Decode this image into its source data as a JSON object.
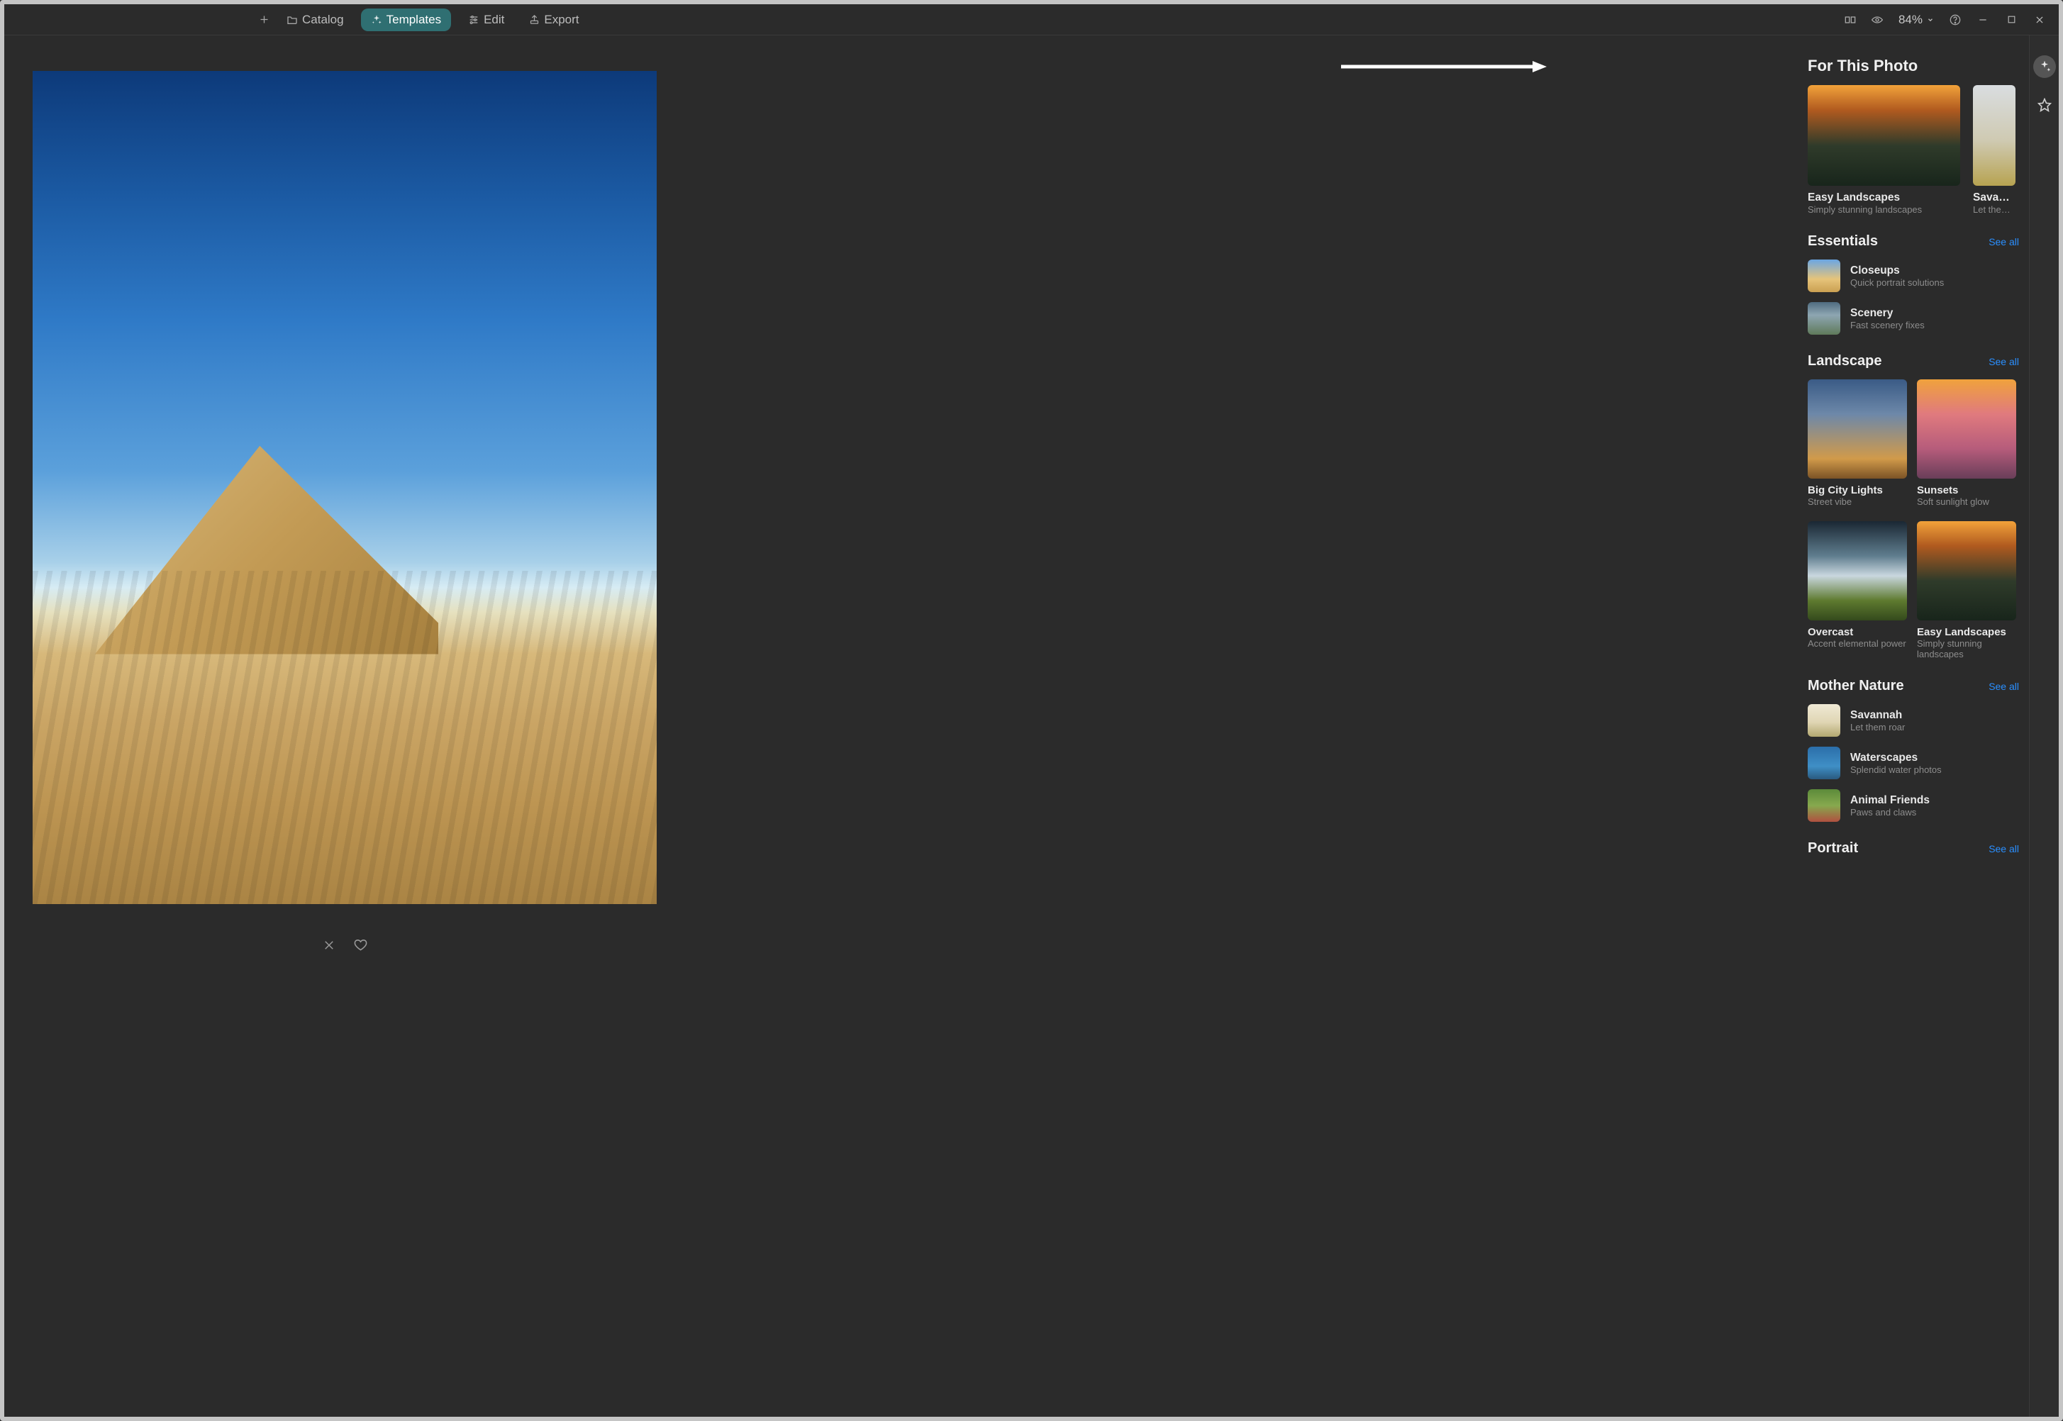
{
  "topbar": {
    "catalog": "Catalog",
    "templates": "Templates",
    "edit": "Edit",
    "export": "Export",
    "zoom": "84%"
  },
  "sidebar": {
    "for_this_photo": {
      "title": "For This Photo",
      "cards": [
        {
          "title": "Easy Landscapes",
          "sub": "Simply stunning landscapes"
        },
        {
          "title": "Savannah",
          "sub": "Let them roar"
        }
      ]
    },
    "essentials": {
      "title": "Essentials",
      "see_all": "See all",
      "items": [
        {
          "title": "Closeups",
          "sub": "Quick portrait solutions"
        },
        {
          "title": "Scenery",
          "sub": "Fast scenery fixes"
        }
      ]
    },
    "landscape": {
      "title": "Landscape",
      "see_all": "See all",
      "cards": [
        {
          "title": "Big City Lights",
          "sub": "Street vibe"
        },
        {
          "title": "Sunsets",
          "sub": "Soft sunlight glow"
        },
        {
          "title": "Overcast",
          "sub": "Accent elemental power"
        },
        {
          "title": "Easy Landscapes",
          "sub": "Simply stunning landscapes"
        }
      ]
    },
    "mother_nature": {
      "title": "Mother Nature",
      "see_all": "See all",
      "items": [
        {
          "title": "Savannah",
          "sub": "Let them roar"
        },
        {
          "title": "Waterscapes",
          "sub": "Splendid water photos"
        },
        {
          "title": "Animal Friends",
          "sub": "Paws and claws"
        }
      ]
    },
    "portrait": {
      "title": "Portrait",
      "see_all": "See all"
    }
  }
}
